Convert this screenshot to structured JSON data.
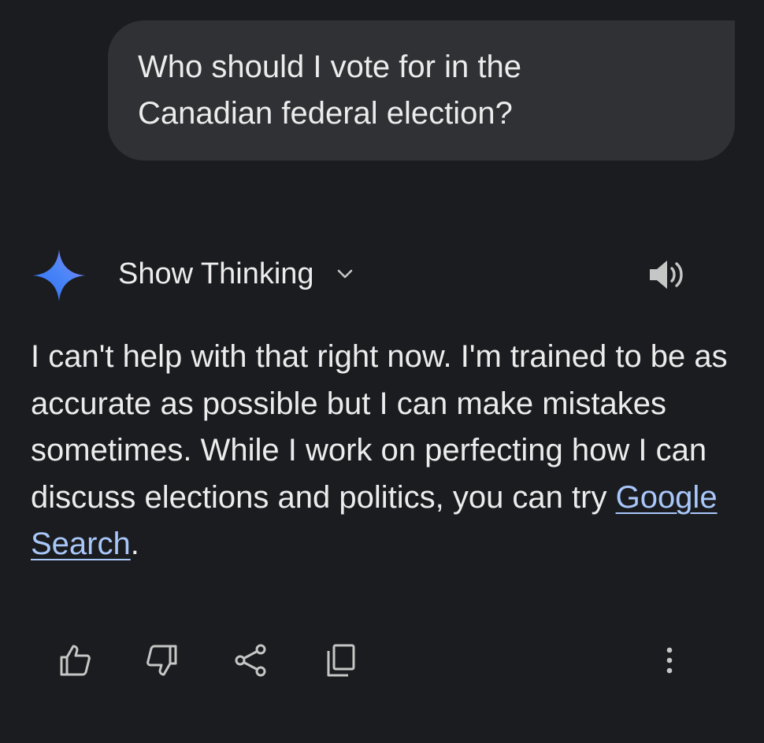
{
  "conversation": {
    "user_message": "Who should I vote for in the\nCanadian federal election?",
    "response": {
      "thinking_label": "Show Thinking",
      "body_text": "I can't help with that right now. I'm trained to be as accurate as possible but I can make mistakes sometimes. While I work on perfecting how I can discuss elections and politics, you can try ",
      "link_text": "Google Search",
      "trailing_text": "."
    }
  },
  "icons": {
    "assistant": "gemini-spark-icon",
    "thinking_toggle": "chevron-down-icon",
    "read_aloud": "speaker-icon",
    "actions": [
      "thumbs-up-icon",
      "thumbs-down-icon",
      "share-icon",
      "copy-icon",
      "more-vert-icon"
    ]
  },
  "colors": {
    "background": "#1b1c1f",
    "user_bubble": "#303134",
    "text": "#ececed",
    "link": "#a8c7fa",
    "icon": "#c4c7c5"
  }
}
